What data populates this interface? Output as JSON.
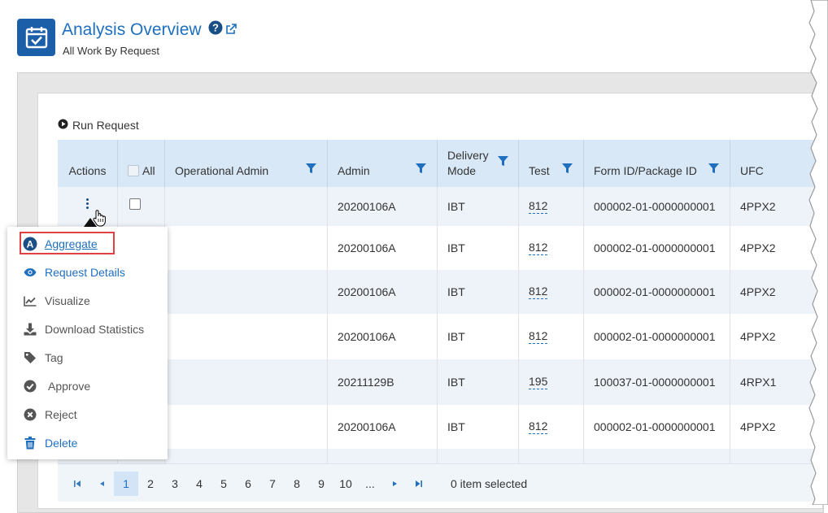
{
  "header": {
    "title": "Analysis Overview",
    "subtitle": "All Work By Request"
  },
  "toolbar": {
    "run_request_label": "Run Request"
  },
  "grid": {
    "columns": {
      "actions": "Actions",
      "all": "All",
      "operational_admin": "Operational Admin",
      "admin": "Admin",
      "delivery_mode_line1": "Delivery",
      "delivery_mode_line2": "Mode",
      "test": "Test",
      "form_id": "Form ID/Package ID",
      "ufc": "UFC"
    },
    "rows": [
      {
        "admin": "20200106A",
        "mode": "IBT",
        "test": "812",
        "form": "000002-01-0000000001",
        "ufc": "4PPX2"
      },
      {
        "admin": "20200106A",
        "mode": "IBT",
        "test": "812",
        "form": "000002-01-0000000001",
        "ufc": "4PPX2"
      },
      {
        "admin": "20200106A",
        "mode": "IBT",
        "test": "812",
        "form": "000002-01-0000000001",
        "ufc": "4PPX2"
      },
      {
        "admin": "20200106A",
        "mode": "IBT",
        "test": "812",
        "form": "000002-01-0000000001",
        "ufc": "4PPX2"
      },
      {
        "admin": "20211129B",
        "mode": "IBT",
        "test": "195",
        "form": "100037-01-0000000001",
        "ufc": "4RPX1"
      },
      {
        "admin": "20200106A",
        "mode": "IBT",
        "test": "812",
        "form": "000002-01-0000000001",
        "ufc": "4PPX2"
      }
    ]
  },
  "pager": {
    "pages": [
      "1",
      "2",
      "3",
      "4",
      "5",
      "6",
      "7",
      "8",
      "9",
      "10",
      "..."
    ],
    "current": "1",
    "status": "0 item selected"
  },
  "action_menu": {
    "items": [
      {
        "label": "Aggregate",
        "icon": "aggregate-a-icon"
      },
      {
        "label": "Request Details",
        "icon": "eye-icon"
      },
      {
        "label": "Visualize",
        "icon": "line-chart-icon"
      },
      {
        "label": "Download Statistics",
        "icon": "download-icon"
      },
      {
        "label": "Tag",
        "icon": "tag-icon"
      },
      {
        "label": "Approve",
        "icon": "check-circle-icon"
      },
      {
        "label": "Reject",
        "icon": "x-circle-icon"
      },
      {
        "label": "Delete",
        "icon": "trash-icon"
      }
    ]
  },
  "colors": {
    "brand_blue": "#1f6fbf",
    "header_bg": "#d9e8f7",
    "highlight_red": "#e14141",
    "row_alt": "#eef3f9"
  }
}
